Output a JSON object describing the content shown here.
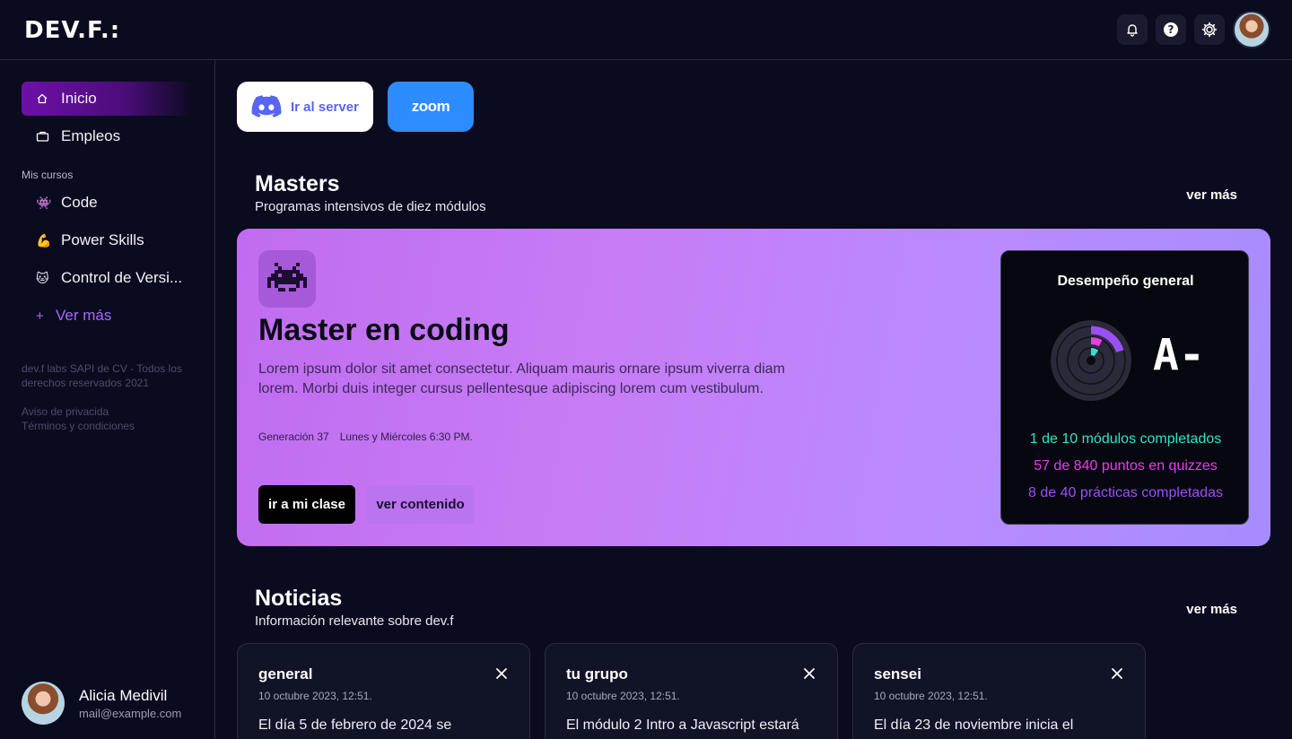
{
  "header": {
    "logo": "DEV.F.:",
    "user_avatar": "user-avatar"
  },
  "sidebar": {
    "items": [
      {
        "label": "Inicio",
        "icon": "home-icon"
      },
      {
        "label": "Empleos",
        "icon": "briefcase-icon"
      }
    ],
    "section_label": "Mis cursos",
    "courses": [
      {
        "label": "Code",
        "icon": "👾"
      },
      {
        "label": "Power Skills",
        "icon": "💪"
      },
      {
        "label": "Control de Versi...",
        "icon": "🐱"
      }
    ],
    "ver_mas": "Ver más",
    "ver_mas_icon": "+",
    "legal_1": "dev.f labs SAPI de CV - Todos los derechos reservados 2021",
    "privacy": "Aviso de privacida",
    "terms": "Términos y condiciones",
    "profile": {
      "name": "Alicia Medivil",
      "email": "mail@example.com"
    }
  },
  "quick_links": {
    "discord_label": "Ir al server",
    "zoom_label": "zoom"
  },
  "masters": {
    "title": "Masters",
    "subtitle": "Programas intensivos de diez módulos",
    "more": "ver más",
    "card": {
      "icon": "👾",
      "title": "Master en coding",
      "description": "Lorem ipsum dolor sit amet consectetur. Aliquam mauris ornare ipsum viverra diam lorem. Morbi duis integer cursus pellentesque adipiscing lorem cum vestibulum.",
      "generation": "Generación 37",
      "schedule": "Lunes y Miércoles 6:30 PM.",
      "primary_button": "ir a mi clase",
      "secondary_button": "ver contenido"
    },
    "performance": {
      "title": "Desempeño general",
      "grade": "A-",
      "stats": [
        {
          "text": "1 de 10 módulos completados",
          "color": "#2ee6c8",
          "fraction": 0.1
        },
        {
          "text": "57 de 840 puntos en quizzes",
          "color": "#e83cf0",
          "fraction": 0.068
        },
        {
          "text": "8 de 40 prácticas completadas",
          "color": "#9b50f5",
          "fraction": 0.2
        }
      ]
    }
  },
  "news": {
    "title": "Noticias",
    "subtitle": "Información relevante sobre dev.f",
    "more": "ver más",
    "cards": [
      {
        "tag": "general",
        "date": "10 octubre 2023, 12:51.",
        "body": "El día 5 de febrero de 2024 se"
      },
      {
        "tag": "tu grupo",
        "date": "10 octubre 2023, 12:51.",
        "body": "El módulo 2 Intro a Javascript estará"
      },
      {
        "tag": "sensei",
        "date": "10 octubre 2023, 12:51.",
        "body": "El día 23 de noviembre inicia el"
      }
    ]
  },
  "colors": {
    "background": "#0a0b1f",
    "accent": "#a56bff",
    "discord": "#5865f2",
    "zoom": "#2d8cff"
  }
}
